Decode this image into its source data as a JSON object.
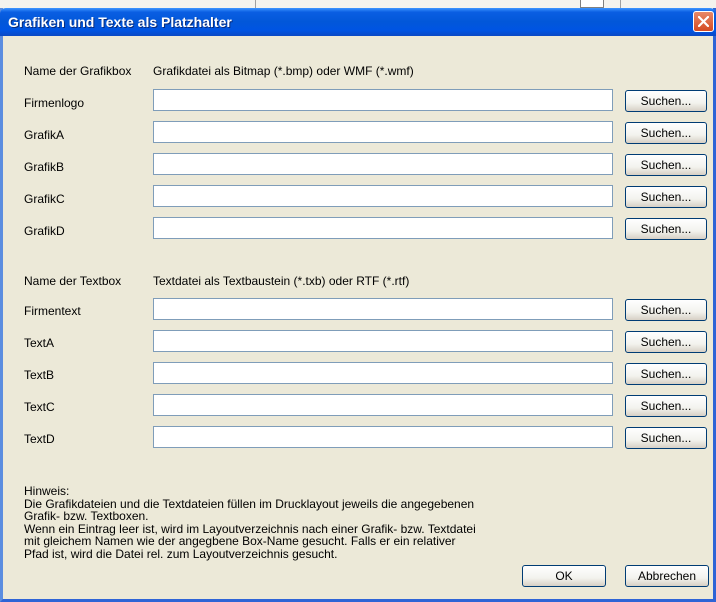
{
  "window": {
    "title": "Grafiken und Texte als Platzhalter"
  },
  "graphics": {
    "header_name": "Name der Grafikbox",
    "header_file": "Grafikdatei als Bitmap (*.bmp) oder WMF (*.wmf)",
    "rows": [
      {
        "label": "Firmenlogo",
        "value": "",
        "button": "Suchen..."
      },
      {
        "label": "GrafikA",
        "value": "",
        "button": "Suchen..."
      },
      {
        "label": "GrafikB",
        "value": "",
        "button": "Suchen..."
      },
      {
        "label": "GrafikC",
        "value": "",
        "button": "Suchen..."
      },
      {
        "label": "GrafikD",
        "value": "",
        "button": "Suchen..."
      }
    ]
  },
  "texts": {
    "header_name": "Name der Textbox",
    "header_file": "Textdatei als Textbaustein (*.txb) oder RTF (*.rtf)",
    "rows": [
      {
        "label": "Firmentext",
        "value": "",
        "button": "Suchen..."
      },
      {
        "label": "TextA",
        "value": "",
        "button": "Suchen..."
      },
      {
        "label": "TextB",
        "value": "",
        "button": "Suchen..."
      },
      {
        "label": "TextC",
        "value": "",
        "button": "Suchen..."
      },
      {
        "label": "TextD",
        "value": "",
        "button": "Suchen..."
      }
    ]
  },
  "note": {
    "lines": [
      "Hinweis:",
      "Die Grafikdateien und die Textdateien füllen im Drucklayout jeweils die angegebenen",
      "Grafik- bzw. Textboxen.",
      "Wenn ein Eintrag leer ist, wird im Layoutverzeichnis nach einer Grafik- bzw. Textdatei",
      "mit gleichem Namen wie der angegbene Box-Name gesucht. Falls er ein relativer",
      "Pfad ist, wird die Datei rel. zum Layoutverzeichnis gesucht."
    ]
  },
  "buttons": {
    "ok": "OK",
    "cancel": "Abbrechen"
  }
}
